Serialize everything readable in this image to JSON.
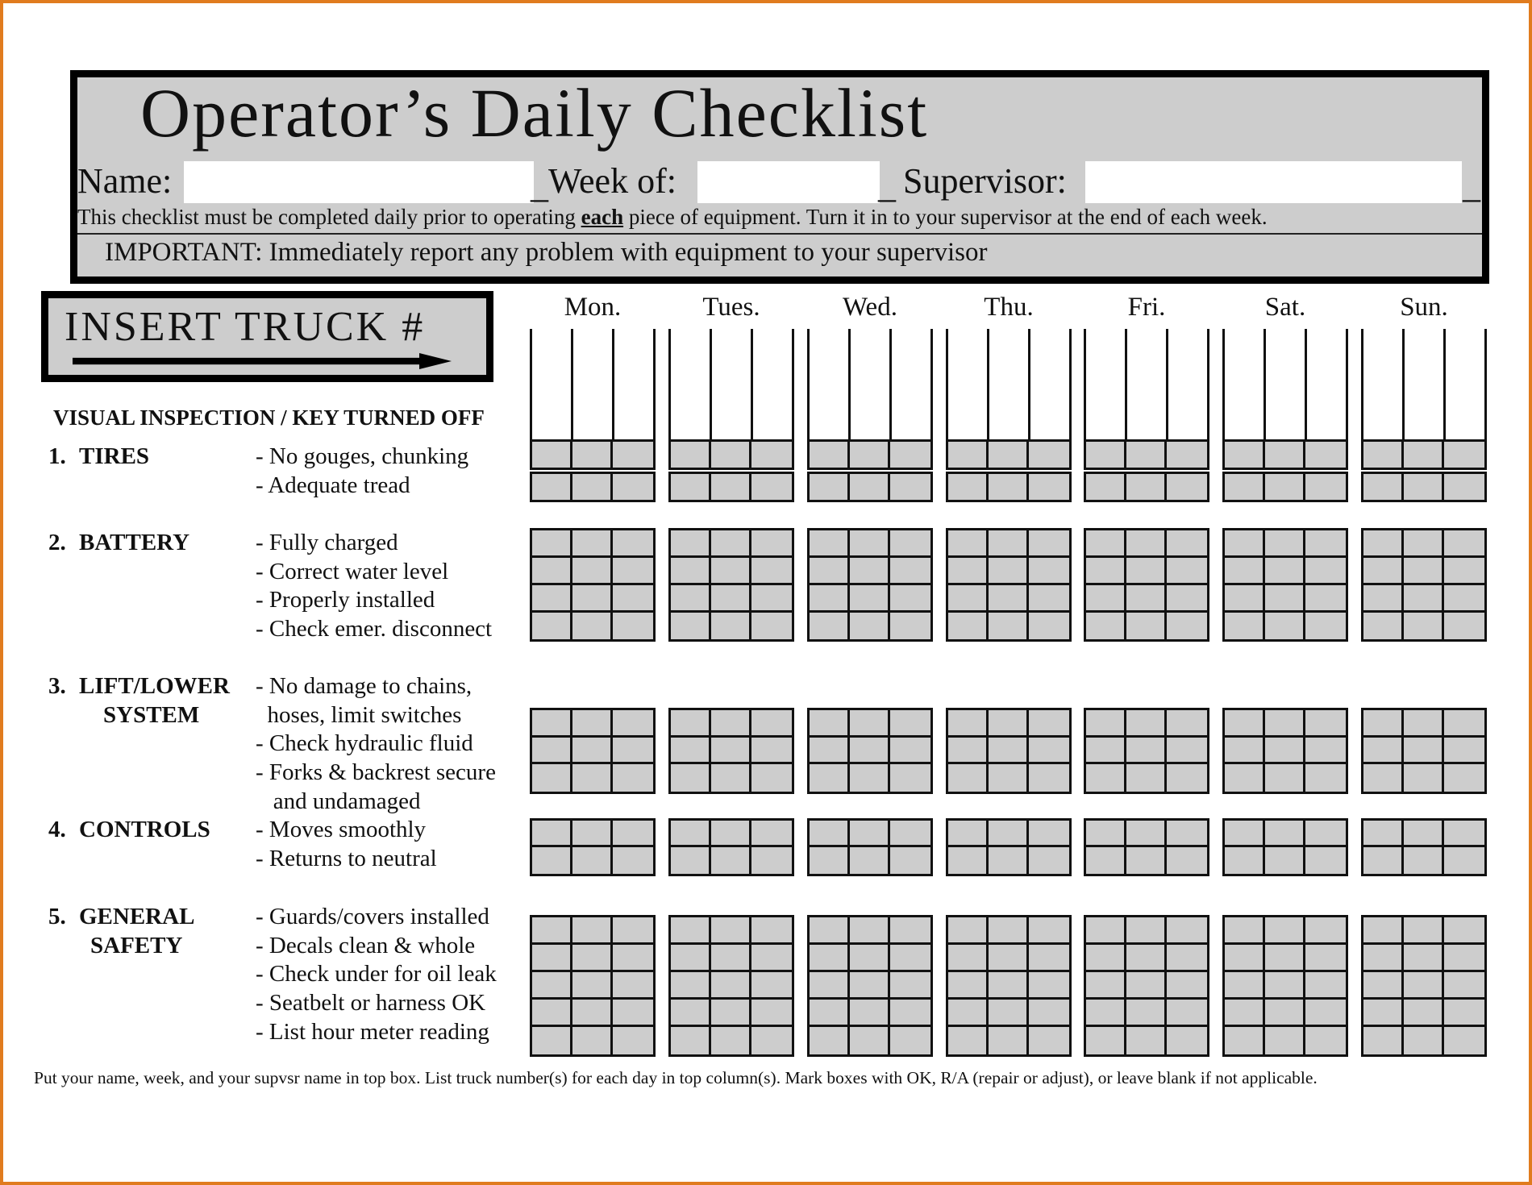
{
  "header": {
    "title": "Operator’s Daily Checklist",
    "name_label": "Name:",
    "name_value": "",
    "week_label": "Week of:",
    "week_value": "",
    "supervisor_label": "Supervisor:",
    "supervisor_value": "",
    "underscore": "_",
    "note_pre": "This checklist must be completed daily prior to operating ",
    "note_emph": "each",
    "note_post": " piece of equipment.  Turn it in to your supervisor at the end of each week.",
    "important": "IMPORTANT:  Immediately report any problem with equipment to your supervisor"
  },
  "truck_box": {
    "label": "INSERT TRUCK #",
    "icon": "arrow-right-icon"
  },
  "days": [
    "Mon.",
    "Tues.",
    "Wed.",
    "Thu.",
    "Fri.",
    "Sat.",
    "Sun."
  ],
  "section_header": "VISUAL INSPECTION / KEY TURNED OFF",
  "sections": [
    {
      "number": "1.",
      "name": "TIRES",
      "name2": "",
      "items": [
        "- No gouges, chunking",
        "- Adequate tread"
      ],
      "rows": 2
    },
    {
      "number": "2.",
      "name": "BATTERY",
      "name2": "",
      "items": [
        "- Fully charged",
        "- Correct water level",
        "- Properly installed",
        "- Check emer. disconnect"
      ],
      "rows": 4
    },
    {
      "number": "3.",
      "name": "LIFT/LOWER",
      "name2": "SYSTEM",
      "items": [
        "- No damage to chains,",
        "  hoses, limit switches",
        "- Check hydraulic fluid",
        "- Forks & backrest secure",
        "   and undamaged"
      ],
      "rows": 3
    },
    {
      "number": "4.",
      "name": "CONTROLS",
      "name2": "",
      "items": [
        "- Moves smoothly",
        "- Returns to neutral"
      ],
      "rows": 2
    },
    {
      "number": "5.",
      "name": "GENERAL",
      "name2": "SAFETY",
      "items": [
        "- Guards/covers installed",
        "- Decals clean & whole",
        "- Check under for oil leak",
        "- Seatbelt or harness OK",
        "- List hour meter reading"
      ],
      "rows": 5
    }
  ],
  "footer": "Put your name, week, and your supvsr name in top box.  List truck number(s) for each day in top column(s). Mark boxes with OK, R/A (repair or adjust), or leave blank if not applicable.",
  "colors": {
    "border_accent": "#e07b1e",
    "panel_grey": "#cdcdcd",
    "ink": "#111111"
  }
}
